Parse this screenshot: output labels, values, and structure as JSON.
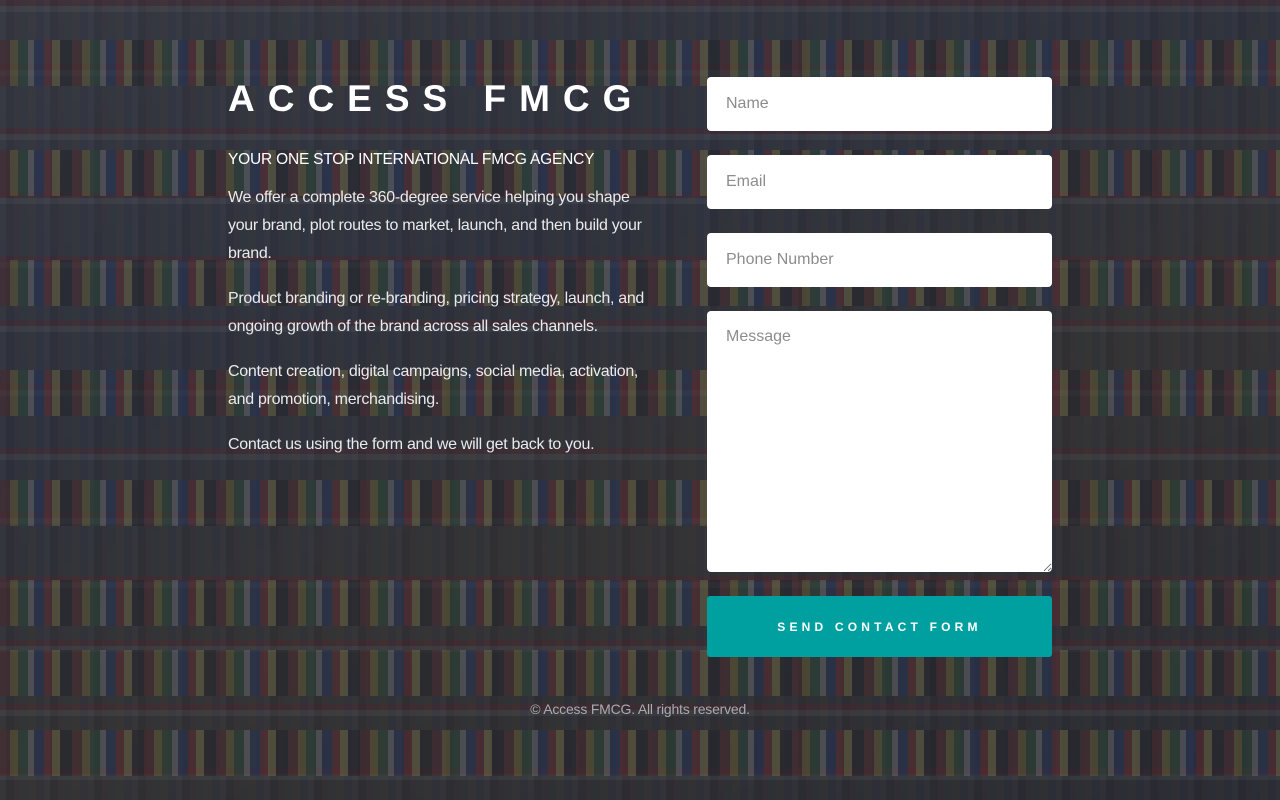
{
  "brand": {
    "name": "ACCESS FMCG",
    "tagline": "YOUR ONE STOP INTERNATIONAL FMCG AGENCY"
  },
  "intro": {
    "paragraphs": [
      "We offer a complete 360-degree service helping you shape your brand, plot routes to market, launch, and then build your brand.",
      "Product branding or re-branding, pricing strategy, launch, and ongoing growth of the brand across all sales channels.",
      "Content creation, digital campaigns, social media, activation, and promotion, merchandising.",
      "Contact us using the form and we will get back to you."
    ]
  },
  "form": {
    "name": {
      "value": "",
      "placeholder": "Name"
    },
    "email": {
      "value": "",
      "placeholder": "Email"
    },
    "phone": {
      "value": "",
      "placeholder": "Phone Number"
    },
    "message": {
      "value": "",
      "placeholder": "Message"
    },
    "submit_label": "SEND CONTACT FORM",
    "accent_color": "#00a0a0"
  },
  "footer": {
    "copyright": "© Access FMCG. All rights reserved."
  },
  "background": {
    "image_subject": "supermarket-shelves-photo",
    "overlay_color": "#1e2028"
  }
}
